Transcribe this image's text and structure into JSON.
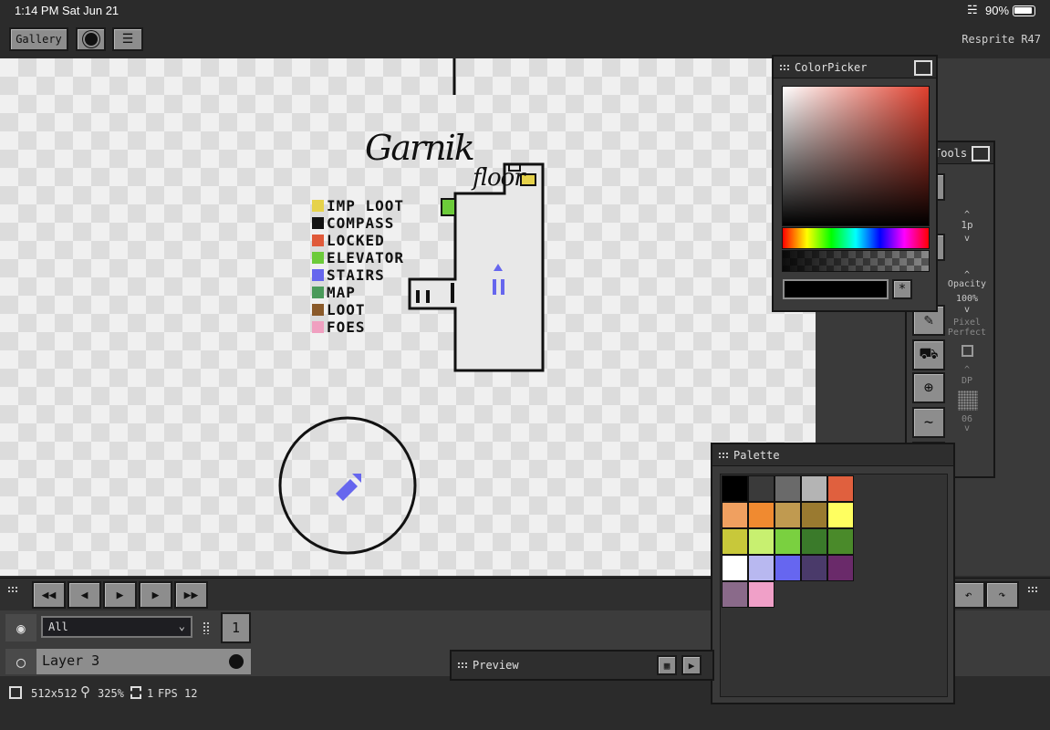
{
  "status_bar": {
    "time": "1:14 PM",
    "date": "Sat Jun 21",
    "battery": "90%"
  },
  "toolbar": {
    "gallery_label": "Gallery",
    "version": "Resprite R47"
  },
  "canvas": {
    "title": "Garnik",
    "subtitle": "floor",
    "legend": [
      {
        "label": "IMP LOOT",
        "color": "#e6d24a"
      },
      {
        "label": "COMPASS",
        "color": "#111111"
      },
      {
        "label": "LOCKED",
        "color": "#e05a3a"
      },
      {
        "label": "ELEVATOR",
        "color": "#6ccb3a"
      },
      {
        "label": "STAIRS",
        "color": "#6666ee"
      },
      {
        "label": "MAP",
        "color": "#4a9a5a"
      },
      {
        "label": "LOOT",
        "color": "#8a5a2a"
      },
      {
        "label": "FOES",
        "color": "#f0a0c0"
      }
    ]
  },
  "color_picker": {
    "title": "ColorPicker",
    "hex_value": "",
    "eyedropper": "*"
  },
  "tools": {
    "title": "Tools",
    "size": "1p",
    "opacity_label": "Opacity",
    "opacity_value": "100%",
    "pixel_perfect_label": "Pixel Perfect",
    "dp_label": "DP",
    "dp_value": "06"
  },
  "palette": {
    "title": "Palette",
    "colors": [
      "#000000",
      "#3a3a3a",
      "#6a6a6a",
      "#b4b4b4",
      "#e0603e",
      "#f0a060",
      "#f08a30",
      "#c09a50",
      "#9a7a30",
      "#ffff60",
      "#c8c83a",
      "#c8f070",
      "#7ad040",
      "#3a7a2a",
      "#4a8a2a",
      "#ffffff",
      "#b8b8f0",
      "#6666f0",
      "#4a3a6a",
      "#6a2a6a",
      "#8a6a8a",
      "#f0a0c8"
    ]
  },
  "timeline": {
    "frame_number": "1"
  },
  "layers": {
    "filter_value": "All",
    "layer_name": "Layer 3"
  },
  "preview": {
    "title": "Preview"
  },
  "bottom_status": {
    "dimensions": "512x512",
    "zoom": "325%",
    "frames": "1",
    "fps_label": "FPS",
    "fps_value": "12"
  }
}
